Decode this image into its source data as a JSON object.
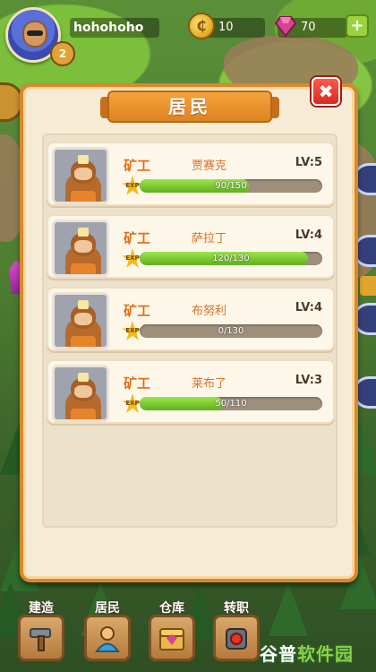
{
  "player": {
    "name": "hohohoho",
    "level": "2",
    "coins": "10",
    "gems": "70",
    "add_label": "+"
  },
  "dialog": {
    "title": "居民",
    "close_label": "✖",
    "exp_badge": "EXP",
    "residents": [
      {
        "job": "矿工",
        "name": "贾赛克",
        "level": "LV:5",
        "exp_text": "90/150",
        "exp_fraction": 0.6
      },
      {
        "job": "矿工",
        "name": "萨拉丁",
        "level": "LV:4",
        "exp_text": "120/130",
        "exp_fraction": 0.923
      },
      {
        "job": "矿工",
        "name": "布努利",
        "level": "LV:4",
        "exp_text": "0/130",
        "exp_fraction": 0.0
      },
      {
        "job": "矿工",
        "name": "莱布了",
        "level": "LV:3",
        "exp_text": "50/110",
        "exp_fraction": 0.455
      }
    ]
  },
  "bottom_nav": [
    {
      "label": "建造",
      "icon": "hammer-icon"
    },
    {
      "label": "居民",
      "icon": "resident-icon"
    },
    {
      "label": "仓库",
      "icon": "chest-icon"
    },
    {
      "label": "转职",
      "icon": "job-change-icon"
    }
  ],
  "watermark": {
    "part1": "谷普",
    "part2": "软件园"
  },
  "colors": {
    "accent": "#dd8423",
    "exp_fill": "#7ccb33",
    "close": "#e03527"
  }
}
